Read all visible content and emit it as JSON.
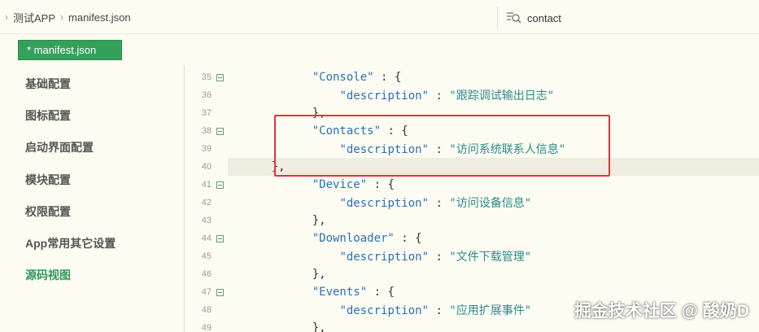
{
  "breadcrumb": [
    "测试APP",
    "manifest.json"
  ],
  "search": {
    "value": "contact"
  },
  "tab": {
    "label": "* manifest.json"
  },
  "nav": {
    "items": [
      {
        "label": "基础配置",
        "active": false
      },
      {
        "label": "图标配置",
        "active": false
      },
      {
        "label": "启动界面配置",
        "active": false
      },
      {
        "label": "模块配置",
        "active": false
      },
      {
        "label": "权限配置",
        "active": false
      },
      {
        "label": "App常用其它设置",
        "active": false
      },
      {
        "label": "源码视图",
        "active": true
      }
    ]
  },
  "code": {
    "lines": [
      {
        "no": "35",
        "indent": "    ",
        "key": "\"Console\"",
        "rest": " : {",
        "fold": true
      },
      {
        "no": "36",
        "indent": "        ",
        "key": "\"description\"",
        "rest": " : ",
        "str": "\"跟踪调试输出日志\"",
        "fold": false
      },
      {
        "no": "37",
        "indent": "    ",
        "rest": "},",
        "fold": false
      },
      {
        "no": "38",
        "indent": "    ",
        "key": "\"Contacts\"",
        "rest": " : {",
        "fold": true
      },
      {
        "no": "39",
        "indent": "        ",
        "key": "\"description\"",
        "rest": " : ",
        "str": "\"访问系统联系人信息\"",
        "fold": false
      },
      {
        "no": "40",
        "indent": "    ",
        "rest": "},",
        "fold": false,
        "highlight": true
      },
      {
        "no": "41",
        "indent": "    ",
        "key": "\"Device\"",
        "rest": " : {",
        "fold": true
      },
      {
        "no": "42",
        "indent": "        ",
        "key": "\"description\"",
        "rest": " : ",
        "str": "\"访问设备信息\"",
        "fold": false
      },
      {
        "no": "43",
        "indent": "    ",
        "rest": "},",
        "fold": false
      },
      {
        "no": "44",
        "indent": "    ",
        "key": "\"Downloader\"",
        "rest": " : {",
        "fold": true
      },
      {
        "no": "45",
        "indent": "        ",
        "key": "\"description\"",
        "rest": " : ",
        "str": "\"文件下载管理\"",
        "fold": false
      },
      {
        "no": "46",
        "indent": "    ",
        "rest": "},",
        "fold": false
      },
      {
        "no": "47",
        "indent": "    ",
        "key": "\"Events\"",
        "rest": " : {",
        "fold": true
      },
      {
        "no": "48",
        "indent": "        ",
        "key": "\"description\"",
        "rest": " : ",
        "str": "\"应用扩展事件\"",
        "fold": false
      },
      {
        "no": "49",
        "indent": "    ",
        "rest": "},",
        "fold": false
      }
    ]
  },
  "watermark": "掘金技术社区 @ 酸奶D",
  "colors": {
    "accent": "#34a15b",
    "annotation": "#e0343b",
    "editor_bg": "#fdfcf3"
  }
}
